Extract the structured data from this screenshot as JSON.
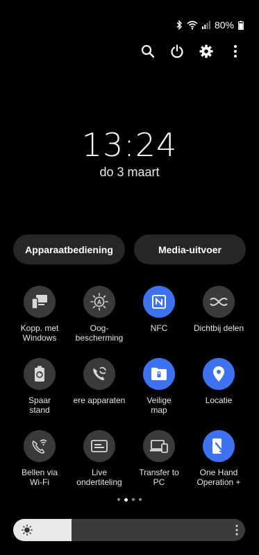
{
  "status": {
    "battery": "80%",
    "icons": [
      "bluetooth-icon",
      "wifi-icon",
      "signal-icon",
      "battery-icon"
    ]
  },
  "actions": [
    "search-icon",
    "power-icon",
    "settings-icon",
    "more-vert-icon"
  ],
  "clock": {
    "time": "13:24",
    "date": "do 3 maart"
  },
  "pills": {
    "left": "Apparaatbediening",
    "right": "Media-uitvoer"
  },
  "tiles": [
    {
      "label": "Kopp. met\nWindows",
      "icon": "link-to-windows-icon",
      "active": false
    },
    {
      "label": "Oog-\nbescherming",
      "icon": "eye-comfort-icon",
      "active": false
    },
    {
      "label": "NFC",
      "icon": "nfc-icon",
      "active": true
    },
    {
      "label": "Dichtbij delen",
      "icon": "nearby-share-icon",
      "active": false
    },
    {
      "label": "Spaar\nstand",
      "icon": "power-saving-icon",
      "active": false
    },
    {
      "label": "ere apparaten",
      "icon": "call-on-other-devices-icon",
      "active": false
    },
    {
      "label": "Veilige\nmap",
      "icon": "secure-folder-icon",
      "active": true
    },
    {
      "label": "Locatie",
      "icon": "location-icon",
      "active": true
    },
    {
      "label": "Bellen via\nWi-Fi",
      "icon": "wifi-calling-icon",
      "active": false
    },
    {
      "label": "Live\nondertiteling",
      "icon": "live-caption-icon",
      "active": false
    },
    {
      "label": "Transfer to\nPC",
      "icon": "transfer-to-pc-icon",
      "active": false
    },
    {
      "label": "One Hand\nOperation +",
      "icon": "one-hand-operation-icon",
      "active": true
    }
  ],
  "page_indicator": {
    "count": 4,
    "active": 1
  },
  "brightness": {
    "level": 0.25
  },
  "colors": {
    "accent": "#3d72f0",
    "tile_off": "#3a3a3a",
    "pill_bg": "#262626"
  }
}
